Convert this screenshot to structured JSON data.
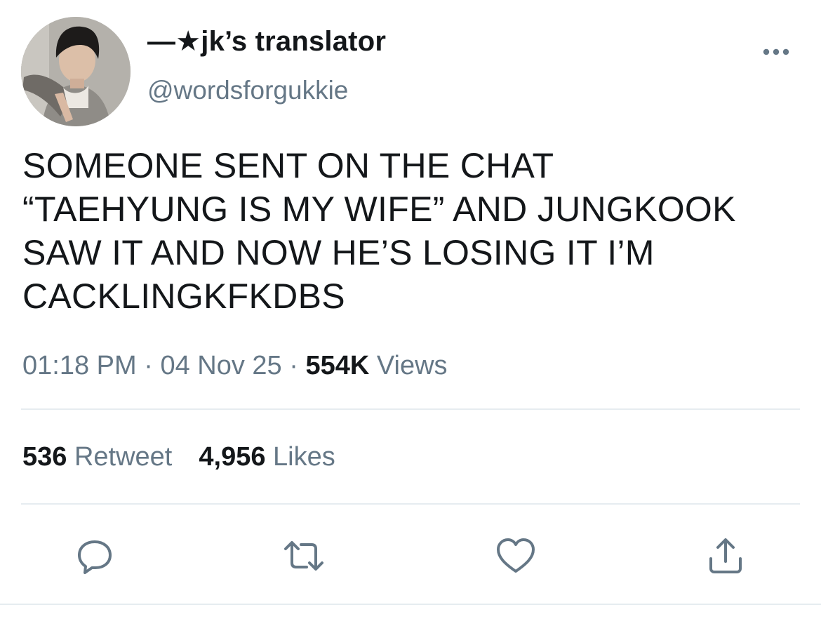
{
  "author": {
    "display_name": "—★jk’s translator",
    "handle": "@wordsforgukkie",
    "avatar_icon": "profile-photo"
  },
  "tweet": {
    "lines": [
      "SOMEONE SENT ON THE CHAT",
      "“TAEHYUNG IS MY WIFE” AND JUNGKOOK",
      "SAW IT AND NOW HE’S LOSING IT I’M",
      "CACKLINGKFKDBS"
    ],
    "time": "01:18 PM",
    "separator": " · ",
    "date": "04 Nov 25",
    "views_count": "554K",
    "views_label": " Views"
  },
  "stats": {
    "retweets_count": "536",
    "retweets_label": " Retweet",
    "likes_count": "4,956",
    "likes_label": " Likes"
  },
  "icons": {
    "more": "more-horizontal-icon",
    "reply": "reply-icon",
    "retweet": "retweet-icon",
    "like": "heart-icon",
    "share": "share-icon"
  },
  "colors": {
    "text": "#14171a",
    "secondary": "#657786",
    "divider": "#e6ecf0"
  }
}
